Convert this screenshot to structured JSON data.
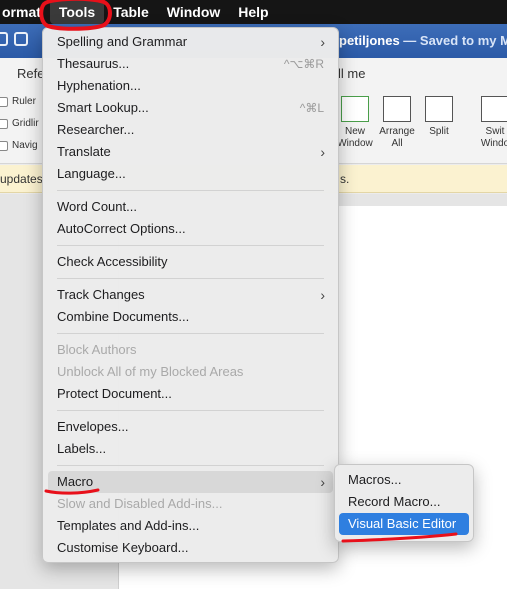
{
  "menubar": {
    "items": [
      "ormat",
      "Tools",
      "Table",
      "Window",
      "Help"
    ]
  },
  "window": {
    "doc_owner": "petiljones",
    "saved_status": " — Saved to my M"
  },
  "ribbon": {
    "tab_left": "Refe",
    "tab_right": "ll me",
    "checkboxes": [
      "Ruler",
      "Gridlir",
      "Navig"
    ],
    "buttons": [
      {
        "line1": "New",
        "line2": "Window"
      },
      {
        "line1": "Arrange",
        "line2": "All"
      },
      {
        "line1": "Split",
        "line2": ""
      },
      {
        "line1": "Swit",
        "line2": "Windo"
      }
    ]
  },
  "infobar": {
    "left": "updates",
    "right": "s."
  },
  "tools_menu": {
    "items": [
      {
        "label": "Spelling and Grammar",
        "submenu": true
      },
      {
        "label": "Thesaurus...",
        "shortcut": "^⌥⌘R"
      },
      {
        "label": "Hyphenation..."
      },
      {
        "label": "Smart Lookup...",
        "shortcut": "^⌘L"
      },
      {
        "label": "Researcher..."
      },
      {
        "label": "Translate",
        "submenu": true
      },
      {
        "label": "Language..."
      },
      {
        "label": "Word Count..."
      },
      {
        "label": "AutoCorrect Options..."
      },
      {
        "label": "Check Accessibility"
      },
      {
        "label": "Track Changes",
        "submenu": true
      },
      {
        "label": "Combine Documents..."
      },
      {
        "label": "Block Authors",
        "disabled": true
      },
      {
        "label": "Unblock All of my Blocked Areas",
        "disabled": true
      },
      {
        "label": "Protect Document..."
      },
      {
        "label": "Envelopes..."
      },
      {
        "label": "Labels..."
      },
      {
        "label": "Macro",
        "submenu": true,
        "highlighted": true
      },
      {
        "label": "Slow and Disabled Add-ins...",
        "disabled": true
      },
      {
        "label": "Templates and Add-ins..."
      },
      {
        "label": "Customise Keyboard..."
      }
    ]
  },
  "macro_submenu": {
    "items": [
      "Macros...",
      "Record Macro...",
      "Visual Basic Editor"
    ],
    "selected": "Visual Basic Editor"
  },
  "colors": {
    "menubar": "#151515",
    "titlebar": "#2b5aa7",
    "selection": "#2f7fe0",
    "annotation": "#e8101a"
  }
}
